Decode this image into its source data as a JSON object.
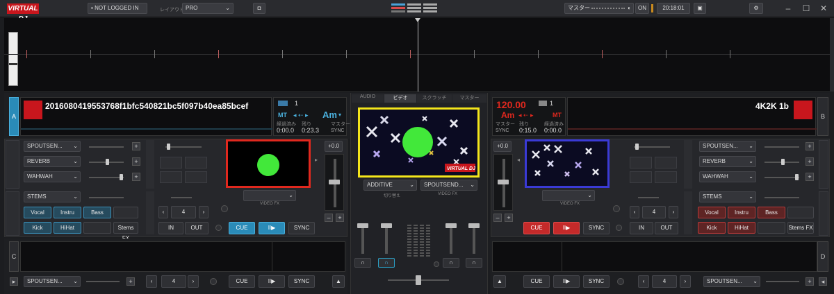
{
  "topbar": {
    "logo": "VIRTUAL DJ",
    "login": "NOT LOGGED IN",
    "layout_label": "レイアウト",
    "layout_value": "PRO",
    "master_label": "マスター",
    "on_label": "ON",
    "clock": "20:18:01"
  },
  "deck_a": {
    "letter": "A",
    "title": "2016080419553768f1bfc540821bc5f097b40ea85bcef",
    "count": "1",
    "mt": "MT",
    "key": "Am",
    "elapsed_label": "経過済み",
    "elapsed": "0:00.0",
    "remain_label": "残り",
    "remain": "0:23.3",
    "master_label": "マスター",
    "sync_label": "SYNC",
    "pitch": "+0.0",
    "fx": [
      "SPOUTSEN...",
      "REVERB",
      "WAHWAH"
    ],
    "video_fx_label": "VIDEO FX",
    "stems_label": "STEMS",
    "pads": [
      "Vocal",
      "Instru",
      "Bass",
      "Kick",
      "HiHat",
      "",
      "Stems FX"
    ],
    "loop_value": "4",
    "cue": "CUE",
    "play": "II▶",
    "sync": "SYNC",
    "in_label": "IN",
    "out_label": "OUT"
  },
  "deck_b": {
    "letter": "B",
    "title": "4K2K 1b",
    "bpm": "120.00",
    "count": "1",
    "key": "Am",
    "mt": "MT",
    "master_label": "マスター",
    "sync_label": "SYNC",
    "remain_label": "残り",
    "remain": "0:15.0",
    "elapsed_label": "経過済み",
    "elapsed": "0:00.0",
    "pitch": "+0.0",
    "fx": [
      "SPOUTSEN...",
      "REVERB",
      "WAHWAH"
    ],
    "video_fx_label": "VIDEO FX",
    "stems_label": "STEMS",
    "pads": [
      "Vocal",
      "Instru",
      "Bass",
      "Kick",
      "HiHat",
      "",
      "Stems FX"
    ],
    "loop_value": "4",
    "cue": "CUE",
    "play": "II▶",
    "sync": "SYNC",
    "in_label": "IN",
    "out_label": "OUT"
  },
  "mixer": {
    "tabs": [
      "AUDIO",
      "ビデオ",
      "スクラッチ",
      "マスター"
    ],
    "crossfader_fx": "ADDITIVE",
    "video_fx_select": "SPOUTSEND...",
    "crossfader_label": "切り替え",
    "video_fx_label": "VIDEO FX",
    "preview_brand": "VIRTUAL DJ"
  },
  "deck_c": {
    "letter": "C",
    "fx": "SPOUTSEN...",
    "loop_value": "4",
    "cue": "CUE",
    "play": "II▶",
    "sync": "SYNC"
  },
  "deck_d": {
    "letter": "D",
    "fx": "SPOUTSEN...",
    "loop_value": "4",
    "cue": "CUE",
    "play": "II▶",
    "sync": "SYNC"
  },
  "colors": {
    "accent_red": "#c8161d",
    "accent_blue": "#2a9ec4",
    "green_dot": "#42e83a",
    "highlight_red": "#e0281e",
    "highlight_yellow": "#f5e61b",
    "highlight_blue": "#3a3ad6"
  }
}
